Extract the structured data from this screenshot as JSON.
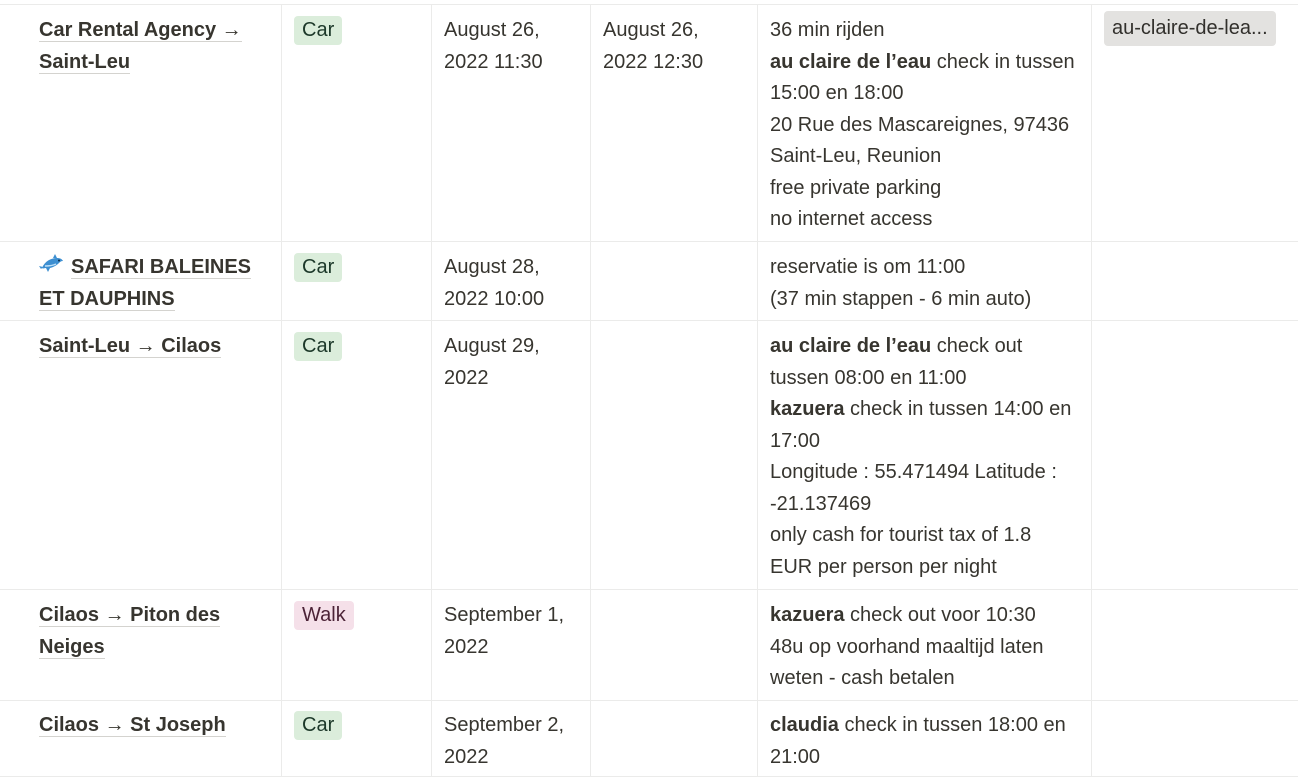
{
  "rows": [
    {
      "name": "Car Rental Agency → Saint-Leu",
      "type": "Car",
      "start": "August 26, 2022 11:30",
      "end": "August 26, 2022 12:30",
      "notes": [
        {
          "bold": "",
          "text": "36 min rijden"
        },
        {
          "bold": "au claire de l’eau",
          "text": " check in tussen 15:00 en 18:00"
        },
        {
          "bold": "",
          "text": "20 Rue des Mascareignes, 97436 Saint-Leu, Reunion"
        },
        {
          "bold": "",
          "text": "free private parking"
        },
        {
          "bold": "",
          "text": "no internet access"
        }
      ],
      "tag": "au-claire-de-lea..."
    },
    {
      "name": "SAFARI BALEINES ET DAUPHINS",
      "icon": "dolphin-icon",
      "type": "Car",
      "start": "August 28, 2022 10:00",
      "end": "",
      "notes": [
        {
          "bold": "",
          "text": "reservatie is om 11:00"
        },
        {
          "bold": "",
          "text": "(37 min stappen - 6 min auto)"
        }
      ],
      "tag": ""
    },
    {
      "name": "Saint-Leu → Cilaos",
      "type": "Car",
      "start": "August 29, 2022",
      "end": "",
      "notes": [
        {
          "bold": "au claire de l’eau",
          "text": " check out tussen 08:00 en 11:00"
        },
        {
          "bold": "kazuera",
          "text": " check in tussen 14:00 en 17:00"
        },
        {
          "bold": "",
          "text": "Longitude : 55.471494 Latitude : -21.137469"
        },
        {
          "bold": "",
          "text": "only cash for tourist tax of 1.8 EUR per person per night"
        }
      ],
      "tag": ""
    },
    {
      "name": "Cilaos → Piton des Neiges",
      "type": "Walk",
      "start": "September 1, 2022",
      "end": "",
      "notes": [
        {
          "bold": "kazuera",
          "text": " check out voor 10:30"
        },
        {
          "bold": "",
          "text": "48u op voorhand maaltijd laten weten - cash betalen"
        }
      ],
      "tag": ""
    },
    {
      "name": "Cilaos → St Joseph",
      "type": "Car",
      "start": "September 2, 2022",
      "end": "",
      "notes": [
        {
          "bold": "claudia",
          "text": " check in tussen 18:00 en 21:00"
        }
      ],
      "tag": ""
    }
  ],
  "colors": {
    "text": "#37352f",
    "border": "#ebebea",
    "tag_car_bg": "#dbeddb",
    "tag_walk_bg": "#f5e0e9",
    "tag_gray_bg": "#e3e2e0"
  }
}
